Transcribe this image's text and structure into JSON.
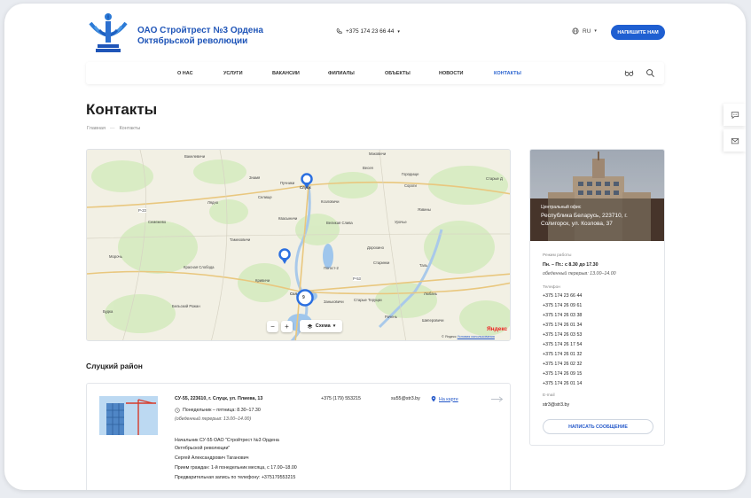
{
  "header": {
    "company_name": "ОАО Стройтрест №3 Ордена Октябрьской революции",
    "phone": "+375 174 23 66 44",
    "language": "RU",
    "write_button": "НАПИШИТЕ НАМ"
  },
  "nav": {
    "items": [
      {
        "label": "О НАС"
      },
      {
        "label": "УСЛУГИ"
      },
      {
        "label": "ВАКАНСИИ"
      },
      {
        "label": "ФИЛИАЛЫ"
      },
      {
        "label": "ОБЪЕКТЫ"
      },
      {
        "label": "НОВОСТИ"
      },
      {
        "label": "КОНТАКТЫ"
      }
    ],
    "active": "КОНТАКТЫ"
  },
  "page": {
    "title": "Контакты",
    "breadcrumb": [
      "Главная",
      "Контакты"
    ]
  },
  "map": {
    "places": [
      "Вакелевичи",
      "Знамя",
      "Пучники",
      "Слуцк",
      "Весея",
      "Маковичи",
      "Городище",
      "Сороги",
      "Старые Д",
      "Селище",
      "Лядно",
      "Козловичи",
      "Семежево",
      "Квасыничи",
      "Великая Слива",
      "Урочье",
      "Язвины",
      "Тамеховичи",
      "Морочь",
      "Красная Слобода",
      "Погост-2",
      "Дорохино",
      "Старинки",
      "Таль",
      "Кривичи",
      "Сол",
      "Любань",
      "Бельский Рожан",
      "Заньковичи",
      "Старые Теруцки",
      "Рачень",
      "Будка",
      "Шиперовичи"
    ],
    "road_labels": [
      "Р-23",
      "Р-53"
    ],
    "cluster_count": "9",
    "zoom_minus": "−",
    "zoom_plus": "+",
    "scheme_label": "Схема",
    "provider": "Яндекс",
    "copyright": "© Яндекс",
    "terms": "Условия использования"
  },
  "office": {
    "label": "Центральный офис",
    "address": "Республика Беларусь, 223710, г. Солигорск, ул. Козлова, 37",
    "hours_label": "Режим работы",
    "hours": "Пн. – Пт.: с 8.30 до 17.30",
    "lunch": "обеденный перерыв: 13.00–14.00",
    "phone_label": "Телефон",
    "phones": [
      "+375 174 23 66 44",
      "+375 174 26 09 61",
      "+375 174 26 03 38",
      "+375 174 26 01 34",
      "+375 174 26 03 53",
      "+375 174 26 17 54",
      "+375 174 26 01 32",
      "+375 174 26 02 32",
      "+375 174 26 09 15",
      "+375 174 26 01 14"
    ],
    "email_label": "E-mail",
    "email": "str3@str3.by",
    "message_button": "НАПИСАТЬ СООБЩЕНИЕ"
  },
  "section": {
    "title": "Слуцкий район"
  },
  "branch": {
    "title": "СУ-55, 223610, г. Слуцк, ул. Плиева, 13",
    "hours": "Понедельник – пятница: 8.30–17.30",
    "lunch": "(обеденный перерыв: 13.00–14.00)",
    "head_title": "Начальник СУ-55 ОАО \"Стройтрест №3 Ордена Октябрьской революции\"",
    "head_name": "Сергей Александрович Таганович",
    "reception": "Прием граждан: 1-й понедельник месяца, с 17.00–18.00",
    "appointment": "Предварительная запись по телефону: +375179553215",
    "phone": "+375 (179) 553215",
    "email": "su55@str3.by",
    "map_link": "На карте"
  }
}
